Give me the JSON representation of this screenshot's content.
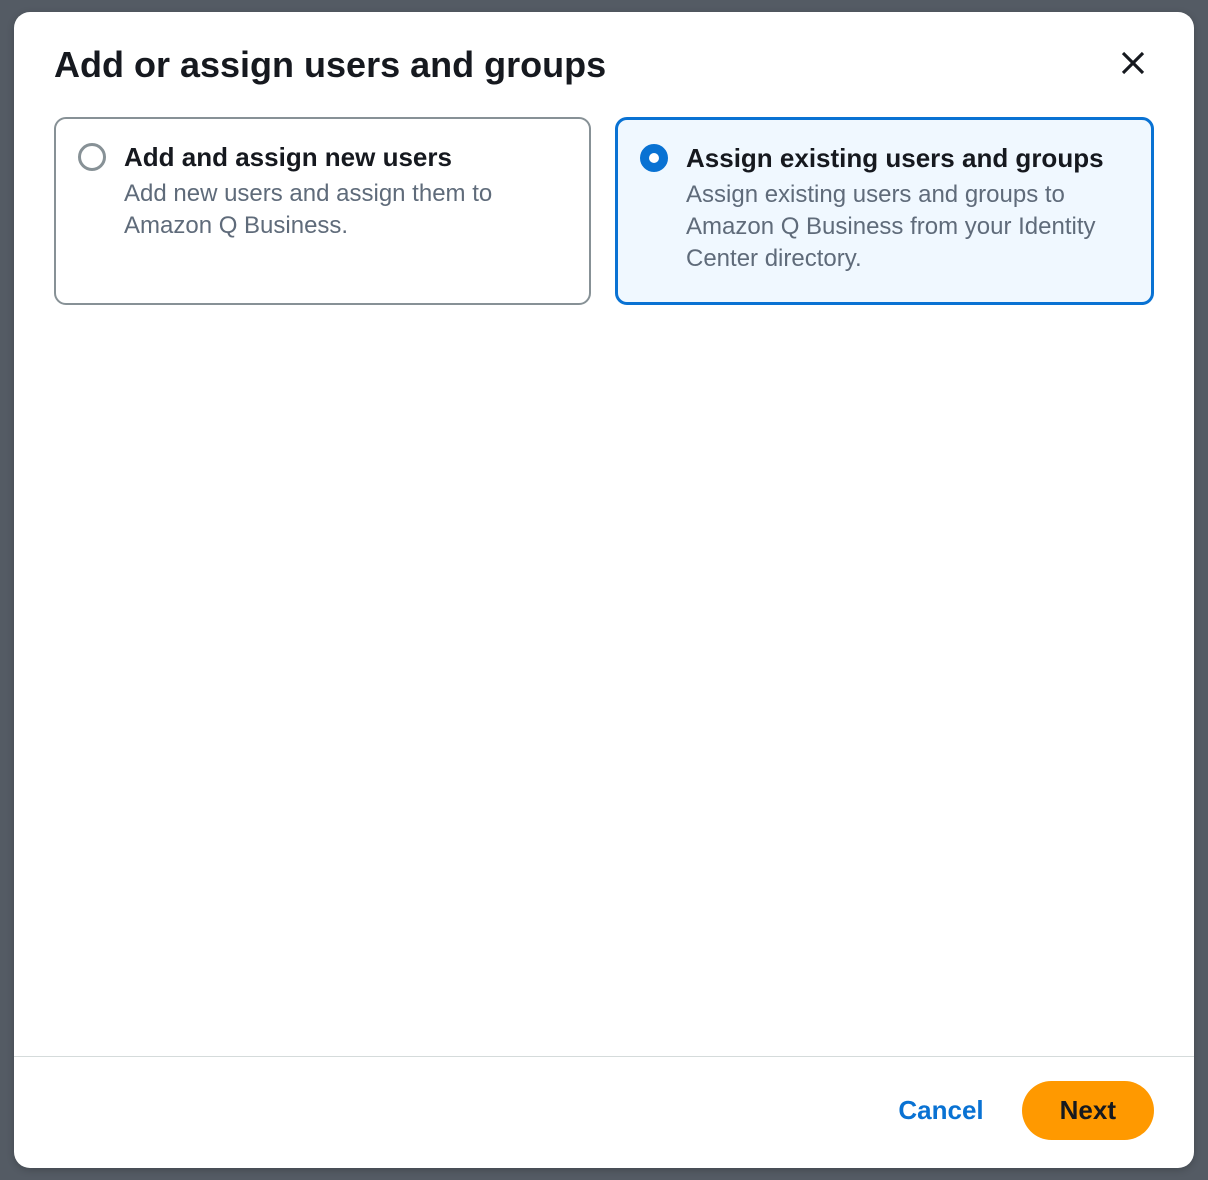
{
  "modal": {
    "title": "Add or assign users and groups",
    "options": [
      {
        "title": "Add and assign new users",
        "description": "Add new users and assign them to Amazon Q Business.",
        "selected": false
      },
      {
        "title": "Assign existing users and groups",
        "description": "Assign existing users and groups to Amazon Q Business from your Identity Center directory.",
        "selected": true
      }
    ],
    "footer": {
      "cancel_label": "Cancel",
      "next_label": "Next"
    }
  }
}
